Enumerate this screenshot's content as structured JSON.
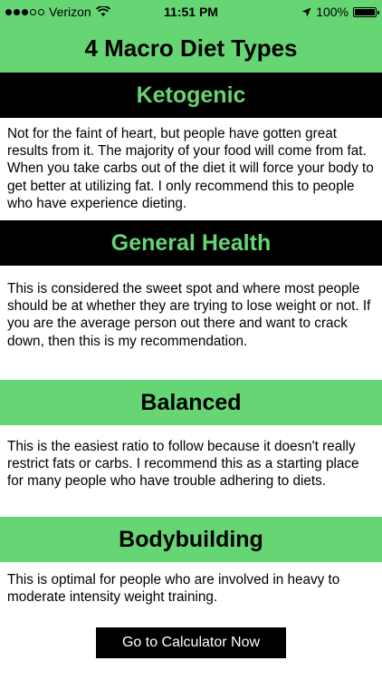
{
  "status_bar": {
    "carrier": "Verizon",
    "time": "11:51 PM",
    "battery": "100%"
  },
  "title": "4 Macro Diet Types",
  "sections": [
    {
      "heading": "Ketogenic",
      "text": "Not for the faint of heart, but people have gotten great results from it. The majority of your food will come from fat. When you take carbs out of the diet it will force your body to get better at utilizing fat. I only recommend this to people who have experience dieting."
    },
    {
      "heading": "General Health",
      "text": "This is considered the sweet spot and where most people should be at whether they are trying to lose weight or not. If you are the average person out there and want to crack down, then this is my recommendation."
    },
    {
      "heading": "Balanced",
      "text": "This is the easiest ratio to follow because it doesn't really restrict fats or carbs. I recommend this as a starting place for many people who have trouble adhering to diets."
    },
    {
      "heading": "Bodybuilding",
      "text": "This is optimal for people who are involved in heavy to moderate intensity weight training."
    }
  ],
  "cta_label": "Go to Calculator Now",
  "colors": {
    "accent_green": "#66d573",
    "dark": "#000000"
  },
  "icons": [
    "signal-dots-icon",
    "wifi-icon",
    "location-arrow-icon",
    "battery-icon"
  ]
}
